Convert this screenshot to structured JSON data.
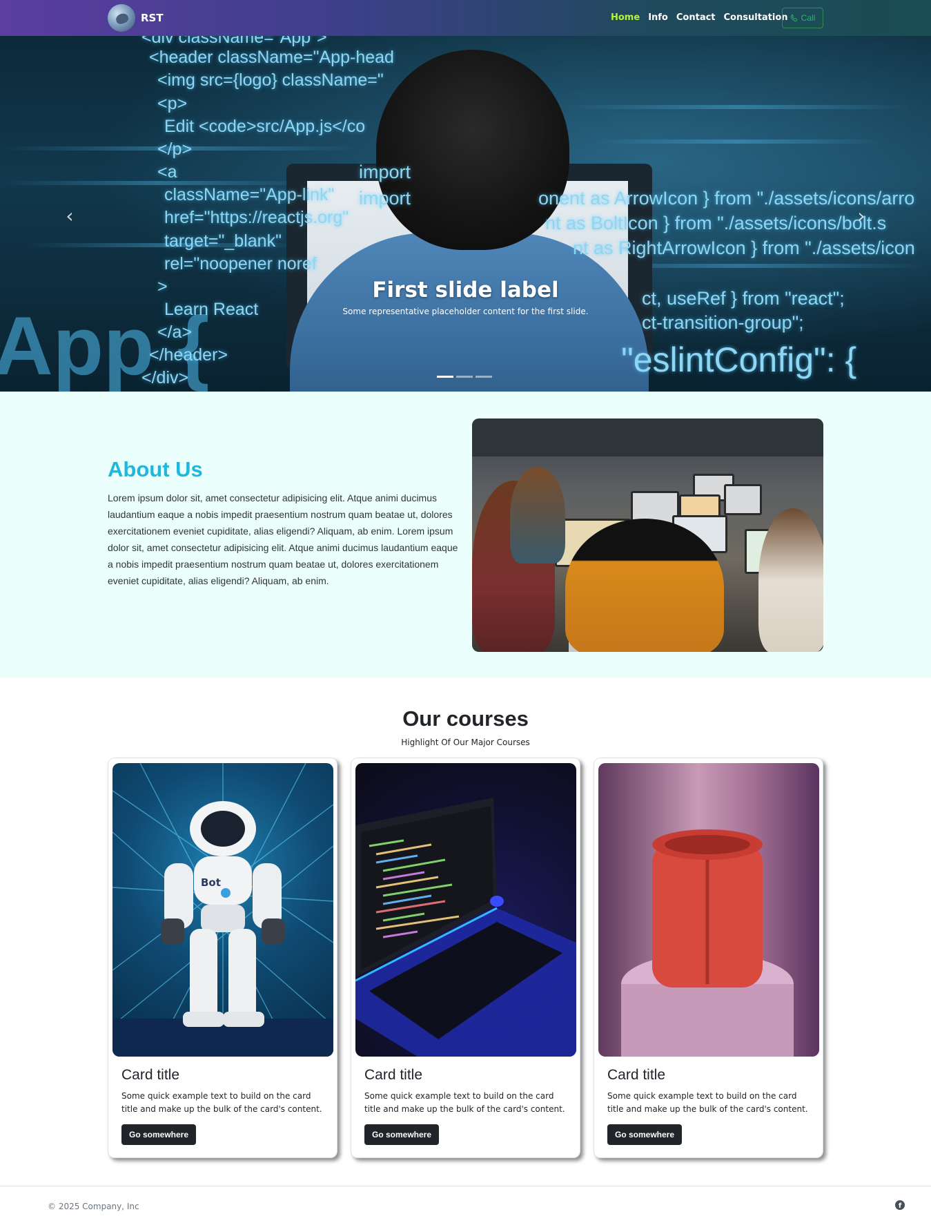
{
  "navbar": {
    "brand": "RST",
    "links": [
      "Home",
      "Info",
      "Contact",
      "Consultation"
    ],
    "call_label": "Call"
  },
  "hero": {
    "code_lines": [
      "<div className=\"App\">",
      "<header className=\"App-head",
      "<img src={logo} className=\"",
      "<p>",
      "Edit <code>src/App.js</co",
      "</p>",
      "<a",
      "className=\"App-link\"",
      "href=\"https://reactjs.org\"",
      "target=\"_blank\"",
      "rel=\"noopener noref",
      ">",
      "Learn React",
      "</a>",
      "</header>",
      "</div>"
    ],
    "right_code": [
      "import",
      "import",
      "onent as ArrowIcon } from \"./assets/icons/arro",
      "nt as BoltIcon } from \"./assets/icons/bolt.s",
      "nt as RightArrowIcon } from \"./assets/icon",
      "ct, useRef } from \"react\";",
      "ct-transition-group\";",
      "\"eslintConfig\": {"
    ],
    "big_text": "App {",
    "caption_title": "First slide label",
    "caption_text": "Some representative placeholder content for the first slide.",
    "indicator_count": 3,
    "active_slide": 1
  },
  "about": {
    "title": "About Us",
    "text": "Lorem ipsum dolor sit, amet consectetur adipisicing elit. Atque animi ducimus laudantium eaque a nobis impedit praesentium nostrum quam beatae ut, dolores exercitationem eveniet cupiditate, alias eligendi? Aliquam, ab enim. Lorem ipsum dolor sit, amet consectetur adipisicing elit. Atque animi ducimus laudantium eaque a nobis impedit praesentium nostrum quam beatae ut, dolores exercitationem eveniet cupiditate, alias eligendi? Aliquam, ab enim."
  },
  "courses": {
    "title": "Our courses",
    "subtitle": "Highlight Of Our Major Courses",
    "cards": [
      {
        "title": "Card title",
        "text": "Some quick example text to build on the card title and make up the bulk of the card's content.",
        "button": "Go somewhere",
        "robot_label": "Bot"
      },
      {
        "title": "Card title",
        "text": "Some quick example text to build on the card title and make up the bulk of the card's content.",
        "button": "Go somewhere"
      },
      {
        "title": "Card title",
        "text": "Some quick example text to build on the card title and make up the bulk of the card's content.",
        "button": "Go somewhere"
      }
    ]
  },
  "footer": {
    "copyright": "© 2025 Company, Inc",
    "social_icon": "facebook-icon"
  },
  "colors": {
    "accent": "#1fb8dc",
    "nav_active": "#b6f23c",
    "call_green": "#2fb36b",
    "about_bg": "#ebfffc",
    "button_dark": "#212529"
  }
}
